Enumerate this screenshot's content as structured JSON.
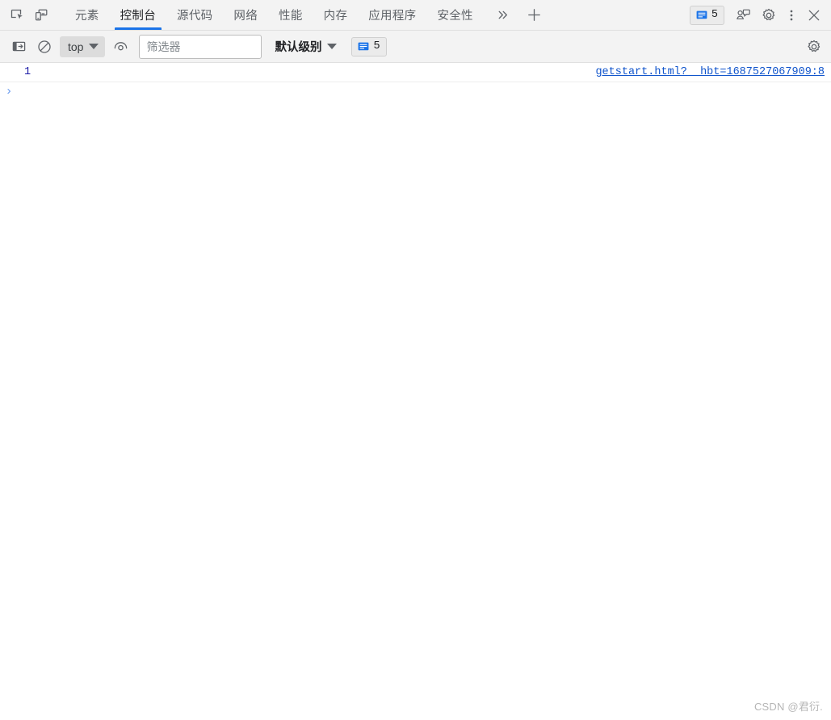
{
  "tabbar": {
    "inspect_icon": "inspect-cursor-icon",
    "device_icon": "device-toolbar-icon",
    "tabs": [
      {
        "label": "元素",
        "name": "elements",
        "active": false
      },
      {
        "label": "控制台",
        "name": "console",
        "active": true
      },
      {
        "label": "源代码",
        "name": "sources",
        "active": false
      },
      {
        "label": "网络",
        "name": "network",
        "active": false
      },
      {
        "label": "性能",
        "name": "performance",
        "active": false
      },
      {
        "label": "内存",
        "name": "memory",
        "active": false
      },
      {
        "label": "应用程序",
        "name": "application",
        "active": false
      },
      {
        "label": "安全性",
        "name": "security",
        "active": false
      }
    ],
    "overflow_label": "»",
    "add_tab_label": "+",
    "issues_count": "5",
    "feedback_icon": "feedback-person-icon",
    "settings_icon": "gear-icon",
    "more_icon": "kebab-menu-icon",
    "close_icon": "close-icon"
  },
  "toolbar": {
    "sidebar_icon": "console-sidebar-icon",
    "clear_icon": "clear-console-icon",
    "context": "top",
    "eye_icon": "live-expression-eye-icon",
    "filter_placeholder": "筛选器",
    "filter_value": "",
    "level": "默认级别",
    "message_count": "5",
    "settings_icon": "gear-icon"
  },
  "console": {
    "rows": [
      {
        "value": "1",
        "source": "getstart.html?__hbt=1687527067909:8"
      }
    ],
    "prompt_arrow": "›",
    "prompt_value": ""
  },
  "watermark": "CSDN @君衍.",
  "colors": {
    "accent": "#1a73e8",
    "link": "#1155cc",
    "value": "#1a1aa6",
    "toolbar_bg": "#f3f3f3",
    "body_bg": "#ffffff"
  }
}
